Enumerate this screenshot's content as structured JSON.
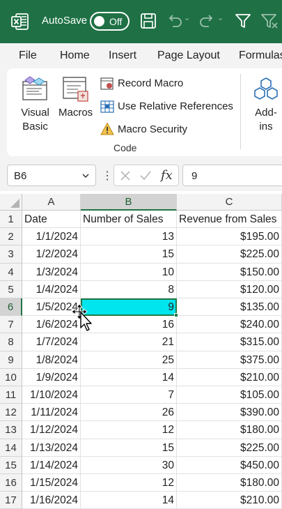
{
  "titlebar": {
    "autosave_label": "AutoSave",
    "autosave_state": "Off"
  },
  "menu": {
    "tabs": [
      "File",
      "Home",
      "Insert",
      "Page Layout",
      "Formulas"
    ]
  },
  "ribbon": {
    "visual_basic": "Visual Basic",
    "macros": "Macros",
    "record_macro": "Record Macro",
    "use_relative_refs": "Use Relative References",
    "macro_security": "Macro Security",
    "group_label": "Code",
    "addins": "Add-ins"
  },
  "formula_bar": {
    "name_box": "B6",
    "fx": "fx",
    "value": "9"
  },
  "sheet": {
    "columns": [
      "A",
      "B",
      "C"
    ],
    "selected_column": "B",
    "selected_row": 6,
    "rows": [
      {
        "num": "1",
        "a": "Date",
        "b": "Number of Sales",
        "c": "Revenue from Sales"
      },
      {
        "num": "2",
        "a": "1/1/2024",
        "b": "13",
        "c": "$195.00"
      },
      {
        "num": "3",
        "a": "1/2/2024",
        "b": "15",
        "c": "$225.00"
      },
      {
        "num": "4",
        "a": "1/3/2024",
        "b": "10",
        "c": "$150.00"
      },
      {
        "num": "5",
        "a": "1/4/2024",
        "b": "8",
        "c": "$120.00"
      },
      {
        "num": "6",
        "a": "1/5/2024",
        "b": "9",
        "c": "$135.00"
      },
      {
        "num": "7",
        "a": "1/6/2024",
        "b": "16",
        "c": "$240.00"
      },
      {
        "num": "8",
        "a": "1/7/2024",
        "b": "21",
        "c": "$315.00"
      },
      {
        "num": "9",
        "a": "1/8/2024",
        "b": "25",
        "c": "$375.00"
      },
      {
        "num": "10",
        "a": "1/9/2024",
        "b": "14",
        "c": "$210.00"
      },
      {
        "num": "11",
        "a": "1/10/2024",
        "b": "7",
        "c": "$105.00"
      },
      {
        "num": "12",
        "a": "1/11/2024",
        "b": "26",
        "c": "$390.00"
      },
      {
        "num": "13",
        "a": "1/12/2024",
        "b": "12",
        "c": "$180.00"
      },
      {
        "num": "14",
        "a": "1/13/2024",
        "b": "15",
        "c": "$225.00"
      },
      {
        "num": "15",
        "a": "1/14/2024",
        "b": "30",
        "c": "$450.00"
      },
      {
        "num": "16",
        "a": "1/15/2024",
        "b": "12",
        "c": "$180.00"
      },
      {
        "num": "17",
        "a": "1/16/2024",
        "b": "14",
        "c": "$210.00"
      }
    ]
  },
  "colors": {
    "titlebar": "#1f7145",
    "selection_fill": "#00e5ee",
    "selection_border": "#1e7a45"
  }
}
